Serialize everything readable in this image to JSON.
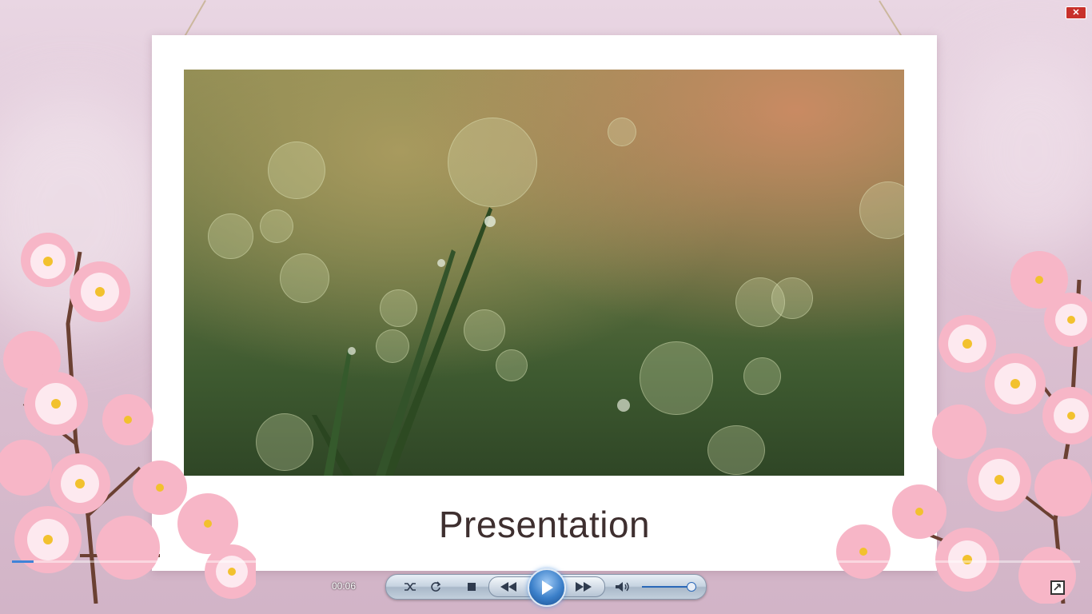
{
  "slide": {
    "caption": "Presentation"
  },
  "window": {
    "close_glyph": "✕"
  },
  "player": {
    "elapsed_time": "00:06",
    "progress": 0.02,
    "volume": 0.95,
    "icons": {
      "shuffle": "shuffle-icon",
      "repeat": "repeat-icon",
      "stop": "stop-icon",
      "previous": "previous-icon",
      "play": "play-icon",
      "next": "next-icon",
      "mute": "volume-icon",
      "fullscreen": "fullscreen-icon"
    },
    "accent_color": "#3f83d8"
  },
  "colors": {
    "background": "#e2cbd9",
    "card": "#ffffff",
    "caption_text": "#3e2f2f"
  }
}
